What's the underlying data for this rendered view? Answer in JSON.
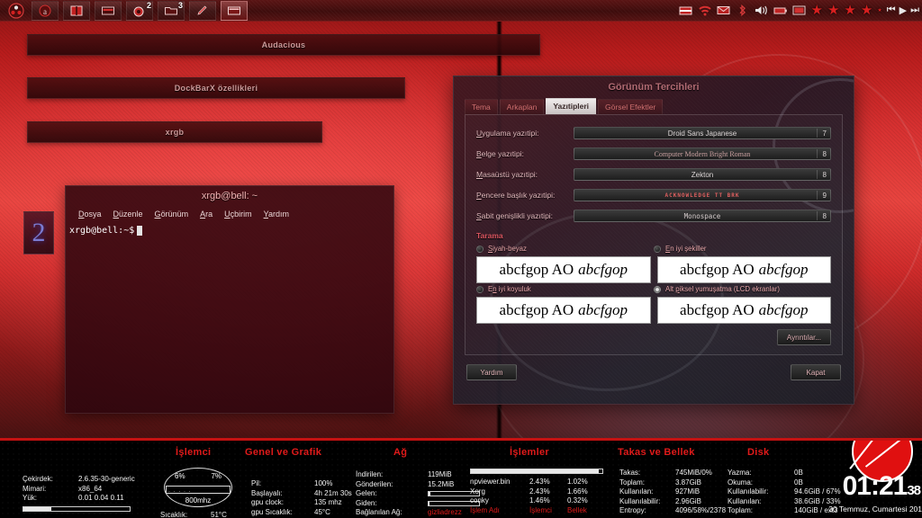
{
  "toppanel": {
    "launcher_icon": "ubuntu-logo-icon",
    "tasks": [
      {
        "name": "task-audacious",
        "icon": "audacious-icon",
        "badge": ""
      },
      {
        "name": "task-dockbarx",
        "icon": "book-icon",
        "badge": ""
      },
      {
        "name": "task-files",
        "icon": "window-icon",
        "badge": ""
      },
      {
        "name": "task-browser",
        "icon": "browser-icon",
        "badge": "2"
      },
      {
        "name": "task-folder",
        "icon": "folder-icon",
        "badge": "3"
      },
      {
        "name": "task-editor",
        "icon": "pencil-icon",
        "badge": ""
      },
      {
        "name": "task-terminal",
        "icon": "terminal-icon",
        "badge": ""
      }
    ],
    "tray": [
      {
        "name": "network-icon",
        "glyph": "▰"
      },
      {
        "name": "wifi-icon",
        "glyph": "◗"
      },
      {
        "name": "mail-icon",
        "glyph": "✉"
      },
      {
        "name": "bluetooth-icon",
        "glyph": "ᛒ"
      },
      {
        "name": "volume-icon",
        "glyph": "🔊"
      },
      {
        "name": "battery-icon",
        "glyph": "▬"
      },
      {
        "name": "display-icon",
        "glyph": "▣"
      }
    ],
    "rating_stars": 4,
    "media": {
      "prev": "⏮",
      "play": "▶",
      "next": "⏭"
    }
  },
  "windows": [
    {
      "title": "Audacious"
    },
    {
      "title": "DockBarX özellikleri"
    },
    {
      "title": "xrgb"
    }
  ],
  "desktop_icon": {
    "label": "2"
  },
  "terminal": {
    "title": "xrgb@bell: ~",
    "menu": [
      "Dosya",
      "Düzenle",
      "Görünüm",
      "Ara",
      "Uçbirim",
      "Yardım"
    ],
    "prompt": "xrgb@bell:~$"
  },
  "appearance": {
    "title": "Görünüm Tercihleri",
    "tabs": [
      {
        "label": "Tema",
        "active": false
      },
      {
        "label": "Arkaplan",
        "active": false
      },
      {
        "label": "Yazıtipleri",
        "active": true
      },
      {
        "label": "Görsel Efektler",
        "active": false
      }
    ],
    "fonts": [
      {
        "label": "Uygulama yazıtipi:",
        "value": "Droid Sans Japanese",
        "size": "7",
        "style": "sans"
      },
      {
        "label": "Belge yazıtipi:",
        "value": "Computer Modern Bright Roman",
        "size": "8",
        "style": "serif"
      },
      {
        "label": "Masaüstü yazıtipi:",
        "value": "Zekton",
        "size": "8",
        "style": "sans"
      },
      {
        "label": "Pencere başlık yazıtipi:",
        "value": "ACKNOWLEDGE TT BRK",
        "size": "9",
        "style": "pix"
      },
      {
        "label": "Sabit genişlikli yazıtipi:",
        "value": "Monospace",
        "size": "8",
        "style": "mono"
      }
    ],
    "rendering_section": "Tarama",
    "rendering_options": [
      {
        "label": "Siyah-beyaz",
        "selected": false
      },
      {
        "label": "En iyi şekiller",
        "selected": false
      },
      {
        "label": "En iyi koyuluk",
        "selected": false
      },
      {
        "label": "Alt piksel yumuşatma (LCD ekranlar)",
        "selected": true
      }
    ],
    "preview_text": "abcfgop AO",
    "preview_italic": "abcfgop",
    "details_button": "Ayrıntılar...",
    "help_button": "Yardım",
    "close_button": "Kapat"
  },
  "conky": {
    "sections": {
      "cpu": "İşlemci",
      "general": "Genel ve Grafik",
      "network": "Ağ",
      "processes": "İşlemler",
      "memory": "Takas ve Bellek",
      "disk": "Disk"
    },
    "system": [
      {
        "key": "Çekirdek:",
        "value": "2.6.35-30-generic"
      },
      {
        "key": "Mimari:",
        "value": "x86_64"
      },
      {
        "key": "Yük:",
        "value": "0.01 0.04 0.11"
      }
    ],
    "load_bar_pct": 26,
    "cpu_gauge": {
      "core1": "6%",
      "core2": "7%",
      "freq": "800mhz"
    },
    "cpu_temp": {
      "key": "Sıcaklık:",
      "value": "51°C"
    },
    "general_stats": [
      {
        "key": "Pil:",
        "value": "100%"
      },
      {
        "key": "Başlayalı:",
        "value": "4h 21m 30s"
      },
      {
        "key": "gpu clock:",
        "value": "135 mhz"
      },
      {
        "key": "gpu Sıcaklık:",
        "value": "45°C"
      }
    ],
    "network_stats": [
      {
        "key": "İndirilen:",
        "value": "119MiB"
      },
      {
        "key": "Gönderilen:",
        "value": "15.2MiB"
      }
    ],
    "network_bars": [
      {
        "key": "Gelen:",
        "pct": 4
      },
      {
        "key": "Giden:",
        "pct": 2
      }
    ],
    "network_conn": {
      "key": "Bağlanılan Ağ:",
      "value": "gizliadrezz"
    },
    "proc_bar_pct": 97,
    "proc_rows": [
      {
        "name": "npviewer.bin",
        "cpu": "2.43%",
        "mem": "1.02%"
      },
      {
        "name": "Xorg",
        "cpu": "2.43%",
        "mem": "1.66%"
      },
      {
        "name": "conky",
        "cpu": "1.46%",
        "mem": "0.32%"
      }
    ],
    "proc_headers": {
      "name": "İşlem Adı",
      "cpu": "İşlemci",
      "mem": "Bellek"
    },
    "memory_rows": [
      {
        "key": "Takas:",
        "value": "745MiB/0%"
      },
      {
        "key": "Toplam:",
        "value": "3.87GiB"
      },
      {
        "key": "Kullanılan:",
        "value": "927MiB"
      },
      {
        "key": "Kullanılabilir:",
        "value": "2.96GiB"
      },
      {
        "key": "Entropy:",
        "value": "4096/58%/2378"
      }
    ],
    "disk_rows": [
      {
        "key": "Yazma:",
        "value": "0B"
      },
      {
        "key": "Okuma:",
        "value": "0B"
      },
      {
        "key": "Kullanılabilir:",
        "value": "94.6GiB / 67%"
      },
      {
        "key": "Kullanılan:",
        "value": "38.6GiB / 33%"
      },
      {
        "key": "Toplam:",
        "value": "140GiB / ext3"
      }
    ],
    "clock": {
      "hm": "01:21",
      "sec": "38"
    },
    "date": "30 Temmuz, Cumartesi 201"
  },
  "colors": {
    "accent_red": "#e01a1a",
    "panel_red": "#c51212",
    "wallpaper_red": "#d93232",
    "dialog_text": "#e3b9bd"
  }
}
